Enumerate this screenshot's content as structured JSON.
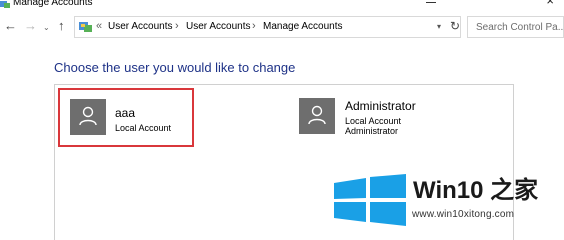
{
  "window": {
    "title": "Manage Accounts",
    "close_glyph": "×"
  },
  "nav": {
    "back_icon": "back-arrow-icon",
    "forward_icon": "forward-arrow-icon",
    "recent_icon": "chevron-down-icon",
    "up_icon": "up-arrow-icon"
  },
  "address": {
    "overflow": "«",
    "breadcrumbs": [
      "User Accounts",
      "User Accounts",
      "Manage Accounts"
    ],
    "separator": "›"
  },
  "search": {
    "placeholder": "Search Control Pa..."
  },
  "main": {
    "heading": "Choose the user you would like to change",
    "accounts": [
      {
        "name": "aaa",
        "lines": [
          "Local Account"
        ],
        "selected": true
      },
      {
        "name": "Administrator",
        "lines": [
          "Local Account",
          "Administrator"
        ],
        "selected": false
      }
    ]
  },
  "watermark": {
    "brand": "Win10 之家",
    "url": "www.win10xitong.com"
  },
  "colors": {
    "heading": "#1e3287",
    "selection_border": "#d9373b",
    "avatar_bg": "#6e6e6e",
    "win_logo": "#1aa0e6"
  }
}
